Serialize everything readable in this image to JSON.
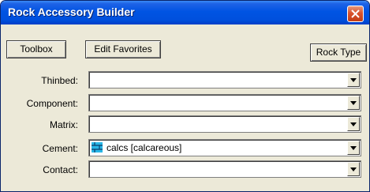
{
  "window": {
    "title": "Rock Accessory Builder"
  },
  "toolbar": {
    "toolbox_label": "Toolbox",
    "edit_favorites_label": "Edit Favorites",
    "rock_type_label": "Rock Type"
  },
  "fields": [
    {
      "label": "Thinbed:",
      "value": ""
    },
    {
      "label": "Component:",
      "value": ""
    },
    {
      "label": "Matrix:",
      "value": ""
    },
    {
      "label": "Cement:",
      "value": "calcs [calcareous]",
      "icon": "calcareous-pattern-icon"
    },
    {
      "label": "Contact:",
      "value": ""
    }
  ],
  "icons": {
    "close": "close-icon",
    "dropdown": "chevron-down-icon"
  },
  "colors": {
    "titlebar": "#0054e3",
    "close_button": "#d9532e",
    "dialog_background": "#ece9d8",
    "pattern_icon": "#29b6e6"
  }
}
